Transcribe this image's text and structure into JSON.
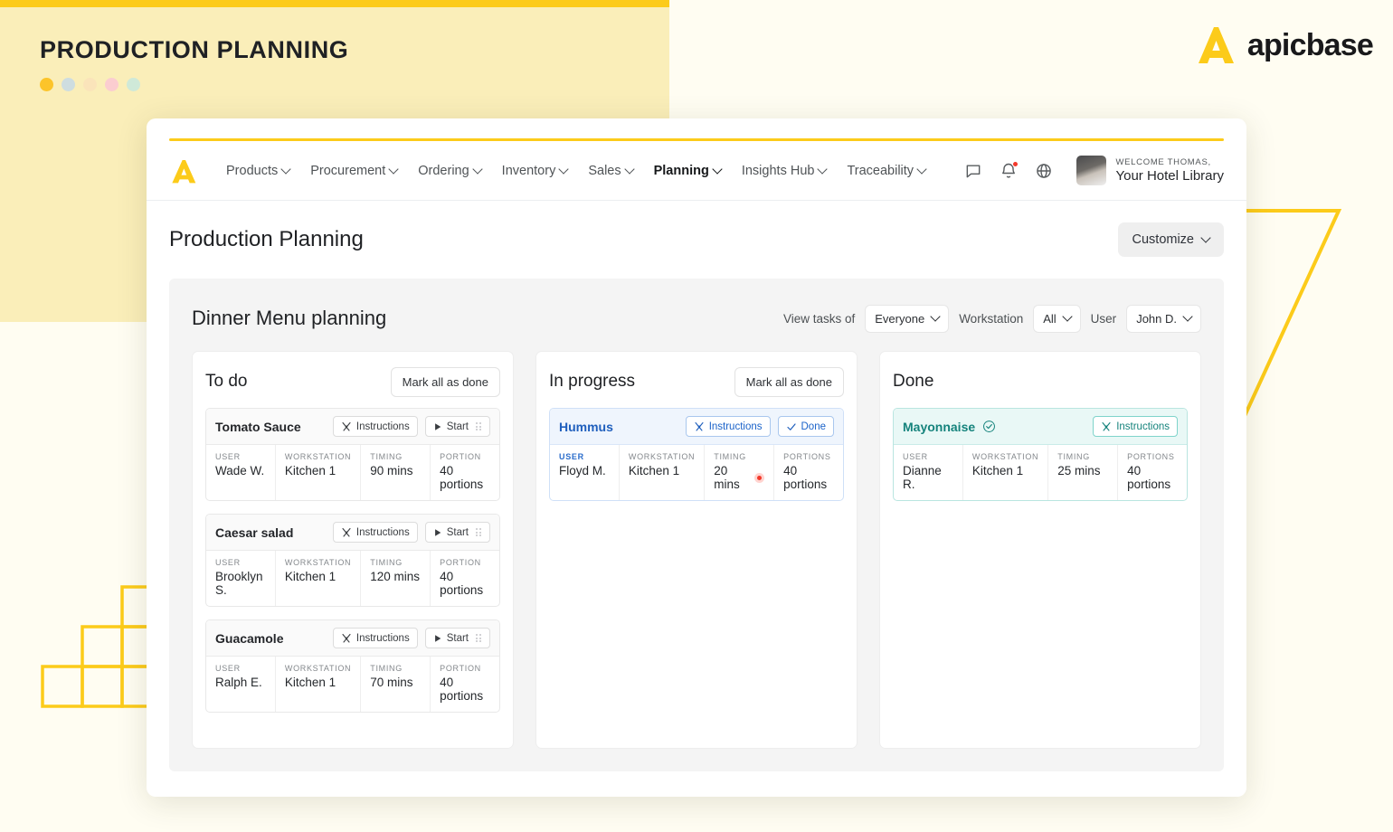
{
  "hero": {
    "title": "PRODUCTION PLANNING",
    "dots": [
      "#fcc42a",
      "#cedde0",
      "#fae4ba",
      "#fbcdd0",
      "#cfe9d8"
    ]
  },
  "brand": {
    "name": "apicbase",
    "mark_color": "#fccb1a"
  },
  "nav": {
    "items": [
      {
        "label": "Products",
        "active": false,
        "caret": true
      },
      {
        "label": "Procurement",
        "active": false,
        "caret": true
      },
      {
        "label": "Ordering",
        "active": false,
        "caret": true
      },
      {
        "label": "Inventory",
        "active": false,
        "caret": true
      },
      {
        "label": "Sales",
        "active": false,
        "caret": true
      },
      {
        "label": "Planning",
        "active": true,
        "caret": true
      },
      {
        "label": "Insights Hub",
        "active": false,
        "caret": true
      },
      {
        "label": "Traceability",
        "active": false,
        "caret": true
      }
    ],
    "icons": [
      "chat-icon",
      "bell-icon",
      "help-icon"
    ],
    "notification_badge": true,
    "user": {
      "welcome": "WELCOME THOMAS,",
      "library": "Your Hotel Library"
    }
  },
  "page": {
    "title": "Production Planning",
    "customize_label": "Customize"
  },
  "board": {
    "title": "Dinner Menu planning",
    "filters": [
      {
        "label": "View tasks of",
        "value": "Everyone"
      },
      {
        "label": "Workstation",
        "value": "All"
      },
      {
        "label": "User",
        "value": "John D."
      }
    ],
    "labels": {
      "instructions": "Instructions",
      "start": "Start",
      "done": "Done",
      "mark_all": "Mark all as done",
      "user": "USER",
      "workstation": "WORKSTATION",
      "timing": "TIMING",
      "portion": "PORTION",
      "portions": "PORTIONS"
    },
    "columns": [
      {
        "title": "To do",
        "state": "todo",
        "has_mark_all": true,
        "cards": [
          {
            "name": "Tomato Sauce",
            "user": "Wade W.",
            "workstation": "Kitchen 1",
            "timing": "90 mins",
            "portion_label": "PORTION",
            "portion": "40 portions",
            "action": "Start"
          },
          {
            "name": "Caesar salad",
            "user": "Brooklyn S.",
            "workstation": "Kitchen 1",
            "timing": "120 mins",
            "portion_label": "PORTION",
            "portion": "40 portions",
            "action": "Start"
          },
          {
            "name": "Guacamole",
            "user": "Ralph E.",
            "workstation": "Kitchen 1",
            "timing": "70 mins",
            "portion_label": "PORTION",
            "portion": "40 portions",
            "action": "Start"
          }
        ]
      },
      {
        "title": "In progress",
        "state": "progress",
        "has_mark_all": true,
        "cards": [
          {
            "name": "Hummus",
            "user": "Floyd M.",
            "workstation": "Kitchen 1",
            "timing": "20 mins",
            "portion_label": "PORTIONS",
            "portion": "40 portions",
            "action": "Done",
            "recording": true
          }
        ]
      },
      {
        "title": "Done",
        "state": "done",
        "has_mark_all": false,
        "cards": [
          {
            "name": "Mayonnaise",
            "user": "Dianne R.",
            "workstation": "Kitchen 1",
            "timing": "25 mins",
            "portion_label": "PORTIONS",
            "portion": "40 portions",
            "action": null,
            "checked": true
          }
        ]
      }
    ]
  },
  "colors": {
    "brand_yellow": "#fccb1a",
    "hero_band": "#faeeb9",
    "progress_blue": "#1f5fbd",
    "done_teal": "#15837c",
    "alert_red": "#f3392b"
  }
}
